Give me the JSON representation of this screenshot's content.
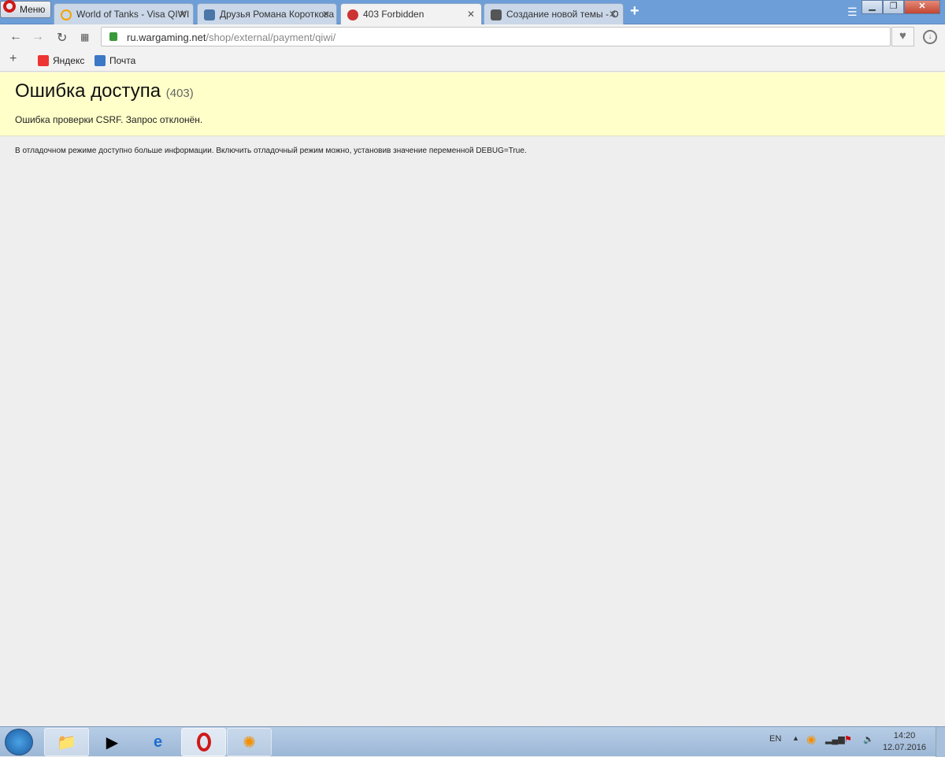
{
  "browser": {
    "menu_label": "Меню",
    "tabs": [
      {
        "title": "World of Tanks - Visa QIWI",
        "icon": "qiwi-icon"
      },
      {
        "title": "Друзья Романа Короткова",
        "icon": "vk-icon"
      },
      {
        "title": "403 Forbidden",
        "icon": "wargaming-icon",
        "active": true
      },
      {
        "title": "Создание новой темы - О",
        "icon": "wot-icon"
      }
    ],
    "url_host": "ru.wargaming.net",
    "url_path": "/shop/external/payment/qiwi/",
    "bookmarks": [
      {
        "label": "Яндекс"
      },
      {
        "label": "Почта"
      }
    ]
  },
  "page": {
    "title": "Ошибка доступа",
    "code": "(403)",
    "message": "Ошибка проверки CSRF. Запрос отклонён.",
    "debug_info": "В отладочном режиме доступно больше информации. Включить отладочный режим можно, установив значение переменной DEBUG=True."
  },
  "taskbar": {
    "lang": "EN",
    "time": "14:20",
    "date": "12.07.2016"
  }
}
